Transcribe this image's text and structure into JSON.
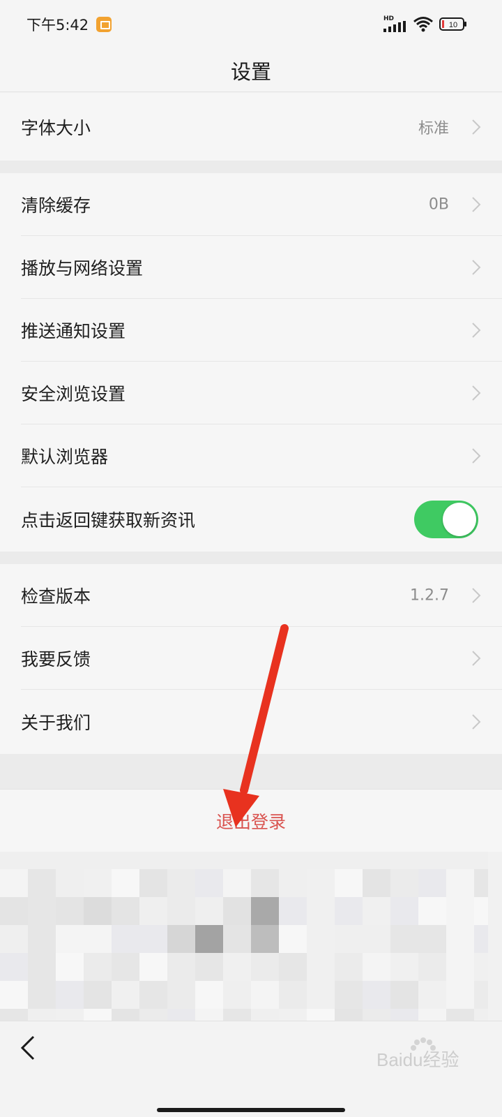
{
  "status_bar": {
    "time": "下午5:42",
    "network": "HD",
    "battery": "10",
    "icons": [
      "notification-app-icon",
      "signal-icon",
      "wifi-icon",
      "battery-icon"
    ]
  },
  "header": {
    "title": "设置"
  },
  "settings": {
    "font_size": {
      "label": "字体大小",
      "value": "标准"
    },
    "clear_cache": {
      "label": "清除缓存",
      "value": "0B"
    },
    "playback_network": {
      "label": "播放与网络设置"
    },
    "push_notifications": {
      "label": "推送通知设置"
    },
    "safe_browsing": {
      "label": "安全浏览设置"
    },
    "default_browser": {
      "label": "默认浏览器"
    },
    "back_key_refresh": {
      "label": "点击返回键获取新资讯",
      "enabled": true
    },
    "check_version": {
      "label": "检查版本",
      "value": "1.2.7"
    },
    "feedback": {
      "label": "我要反馈"
    },
    "about_us": {
      "label": "关于我们"
    }
  },
  "logout": {
    "label": "退出登录"
  },
  "watermark": {
    "text": "Baidu经验"
  },
  "colors": {
    "toggle_on": "#3fca62",
    "logout_text": "#d9534f",
    "annotation_arrow": "#e8321f"
  }
}
